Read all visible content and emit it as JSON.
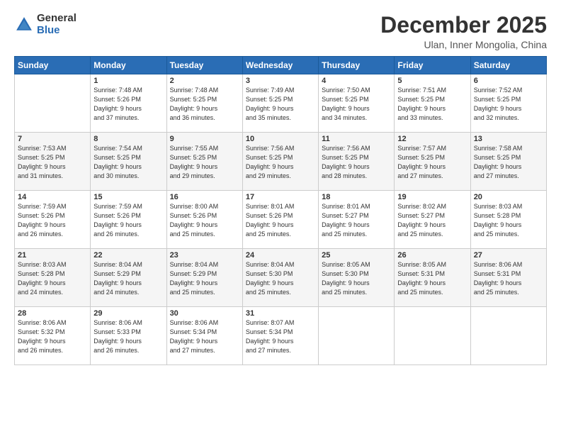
{
  "logo": {
    "general": "General",
    "blue": "Blue"
  },
  "title": "December 2025",
  "subtitle": "Ulan, Inner Mongolia, China",
  "days_header": [
    "Sunday",
    "Monday",
    "Tuesday",
    "Wednesday",
    "Thursday",
    "Friday",
    "Saturday"
  ],
  "weeks": [
    [
      {
        "num": "",
        "info": ""
      },
      {
        "num": "1",
        "info": "Sunrise: 7:48 AM\nSunset: 5:26 PM\nDaylight: 9 hours\nand 37 minutes."
      },
      {
        "num": "2",
        "info": "Sunrise: 7:48 AM\nSunset: 5:25 PM\nDaylight: 9 hours\nand 36 minutes."
      },
      {
        "num": "3",
        "info": "Sunrise: 7:49 AM\nSunset: 5:25 PM\nDaylight: 9 hours\nand 35 minutes."
      },
      {
        "num": "4",
        "info": "Sunrise: 7:50 AM\nSunset: 5:25 PM\nDaylight: 9 hours\nand 34 minutes."
      },
      {
        "num": "5",
        "info": "Sunrise: 7:51 AM\nSunset: 5:25 PM\nDaylight: 9 hours\nand 33 minutes."
      },
      {
        "num": "6",
        "info": "Sunrise: 7:52 AM\nSunset: 5:25 PM\nDaylight: 9 hours\nand 32 minutes."
      }
    ],
    [
      {
        "num": "7",
        "info": "Sunrise: 7:53 AM\nSunset: 5:25 PM\nDaylight: 9 hours\nand 31 minutes."
      },
      {
        "num": "8",
        "info": "Sunrise: 7:54 AM\nSunset: 5:25 PM\nDaylight: 9 hours\nand 30 minutes."
      },
      {
        "num": "9",
        "info": "Sunrise: 7:55 AM\nSunset: 5:25 PM\nDaylight: 9 hours\nand 29 minutes."
      },
      {
        "num": "10",
        "info": "Sunrise: 7:56 AM\nSunset: 5:25 PM\nDaylight: 9 hours\nand 29 minutes."
      },
      {
        "num": "11",
        "info": "Sunrise: 7:56 AM\nSunset: 5:25 PM\nDaylight: 9 hours\nand 28 minutes."
      },
      {
        "num": "12",
        "info": "Sunrise: 7:57 AM\nSunset: 5:25 PM\nDaylight: 9 hours\nand 27 minutes."
      },
      {
        "num": "13",
        "info": "Sunrise: 7:58 AM\nSunset: 5:25 PM\nDaylight: 9 hours\nand 27 minutes."
      }
    ],
    [
      {
        "num": "14",
        "info": "Sunrise: 7:59 AM\nSunset: 5:26 PM\nDaylight: 9 hours\nand 26 minutes."
      },
      {
        "num": "15",
        "info": "Sunrise: 7:59 AM\nSunset: 5:26 PM\nDaylight: 9 hours\nand 26 minutes."
      },
      {
        "num": "16",
        "info": "Sunrise: 8:00 AM\nSunset: 5:26 PM\nDaylight: 9 hours\nand 25 minutes."
      },
      {
        "num": "17",
        "info": "Sunrise: 8:01 AM\nSunset: 5:26 PM\nDaylight: 9 hours\nand 25 minutes."
      },
      {
        "num": "18",
        "info": "Sunrise: 8:01 AM\nSunset: 5:27 PM\nDaylight: 9 hours\nand 25 minutes."
      },
      {
        "num": "19",
        "info": "Sunrise: 8:02 AM\nSunset: 5:27 PM\nDaylight: 9 hours\nand 25 minutes."
      },
      {
        "num": "20",
        "info": "Sunrise: 8:03 AM\nSunset: 5:28 PM\nDaylight: 9 hours\nand 25 minutes."
      }
    ],
    [
      {
        "num": "21",
        "info": "Sunrise: 8:03 AM\nSunset: 5:28 PM\nDaylight: 9 hours\nand 24 minutes."
      },
      {
        "num": "22",
        "info": "Sunrise: 8:04 AM\nSunset: 5:29 PM\nDaylight: 9 hours\nand 24 minutes."
      },
      {
        "num": "23",
        "info": "Sunrise: 8:04 AM\nSunset: 5:29 PM\nDaylight: 9 hours\nand 25 minutes."
      },
      {
        "num": "24",
        "info": "Sunrise: 8:04 AM\nSunset: 5:30 PM\nDaylight: 9 hours\nand 25 minutes."
      },
      {
        "num": "25",
        "info": "Sunrise: 8:05 AM\nSunset: 5:30 PM\nDaylight: 9 hours\nand 25 minutes."
      },
      {
        "num": "26",
        "info": "Sunrise: 8:05 AM\nSunset: 5:31 PM\nDaylight: 9 hours\nand 25 minutes."
      },
      {
        "num": "27",
        "info": "Sunrise: 8:06 AM\nSunset: 5:31 PM\nDaylight: 9 hours\nand 25 minutes."
      }
    ],
    [
      {
        "num": "28",
        "info": "Sunrise: 8:06 AM\nSunset: 5:32 PM\nDaylight: 9 hours\nand 26 minutes."
      },
      {
        "num": "29",
        "info": "Sunrise: 8:06 AM\nSunset: 5:33 PM\nDaylight: 9 hours\nand 26 minutes."
      },
      {
        "num": "30",
        "info": "Sunrise: 8:06 AM\nSunset: 5:34 PM\nDaylight: 9 hours\nand 27 minutes."
      },
      {
        "num": "31",
        "info": "Sunrise: 8:07 AM\nSunset: 5:34 PM\nDaylight: 9 hours\nand 27 minutes."
      },
      {
        "num": "",
        "info": ""
      },
      {
        "num": "",
        "info": ""
      },
      {
        "num": "",
        "info": ""
      }
    ]
  ]
}
